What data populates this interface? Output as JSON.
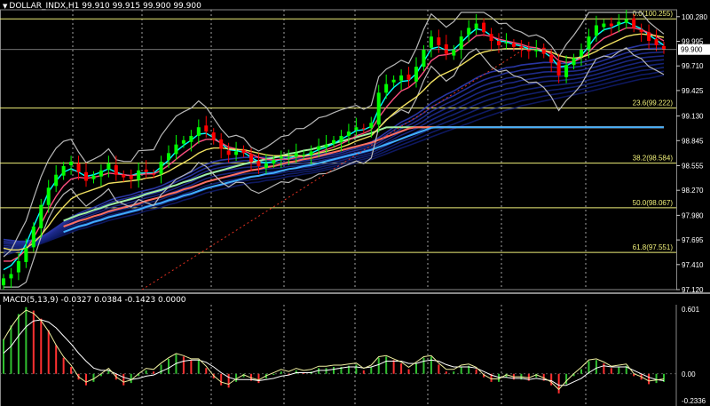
{
  "main_header": {
    "symbol": "DOLLAR_INDX,H1",
    "quote": "99.910 99.915 99.900 99.900",
    "menu_icon": "triangle-down-icon"
  },
  "macd_header": {
    "label": "MACD(5,13,9) -0.0327 0.0384 -0.1423 0.0000"
  },
  "colors": {
    "background": "#000000",
    "bull": "#00ff00",
    "bear": "#ff0000",
    "grid": "#ffffff",
    "fib": "#f0f07a",
    "price_label_bg": "#ffffff",
    "macd_line": "#ffffff"
  },
  "chart_data": [
    {
      "type": "candlestick",
      "title": "DOLLAR_INDX,H1",
      "ylim": [
        97.12,
        100.36
      ],
      "y_ticks": [
        "100.280",
        "99.995",
        "99.710",
        "99.425",
        "99.130",
        "98.845",
        "98.555",
        "98.270",
        "97.980",
        "97.695",
        "97.410",
        "97.120"
      ],
      "last_price": "99.900",
      "fibonacci_levels": [
        {
          "label": "0.0(100.255)",
          "value": 100.255
        },
        {
          "label": "23.6(99.222)",
          "value": 99.222
        },
        {
          "label": "38.2(98.584)",
          "value": 98.584
        },
        {
          "label": "50.0(98.067)",
          "value": 98.067
        },
        {
          "label": "61.8(97.551)",
          "value": 97.551
        }
      ],
      "close": [
        97.25,
        97.3,
        97.45,
        97.6,
        97.85,
        98.1,
        98.3,
        98.45,
        98.55,
        98.6,
        98.48,
        98.38,
        98.44,
        98.5,
        98.58,
        98.45,
        98.42,
        98.4,
        98.5,
        98.48,
        98.46,
        98.6,
        98.7,
        98.8,
        98.85,
        98.9,
        99.0,
        98.95,
        98.85,
        98.75,
        98.68,
        98.72,
        98.7,
        98.6,
        98.55,
        98.58,
        98.62,
        98.66,
        98.65,
        98.7,
        98.68,
        98.72,
        98.78,
        98.8,
        98.85,
        98.9,
        98.95,
        99.0,
        98.98,
        99.05,
        99.4,
        99.5,
        99.55,
        99.6,
        99.55,
        99.7,
        99.9,
        100.05,
        99.95,
        99.85,
        99.9,
        100.05,
        100.15,
        100.2,
        100.1,
        100.0,
        99.95,
        99.98,
        99.93,
        99.92,
        99.88,
        99.9,
        99.85,
        99.75,
        99.6,
        99.72,
        99.8,
        99.9,
        100.05,
        100.18,
        100.2,
        100.17,
        100.22,
        100.25,
        100.15,
        100.1,
        100.0,
        99.95,
        99.9
      ],
      "moving_averages": [
        {
          "color": "#00ffff",
          "values": [
            97.35,
            97.4,
            97.5,
            97.65,
            97.85,
            98.05,
            98.25,
            98.38,
            98.48,
            98.52,
            98.48,
            98.43,
            98.45,
            98.48,
            98.52,
            98.48,
            98.45,
            98.44,
            98.47,
            98.47,
            98.47,
            98.54,
            98.62,
            98.72,
            98.79,
            98.85,
            98.92,
            98.93,
            98.88,
            98.81,
            98.74,
            98.73,
            98.71,
            98.65,
            98.6,
            98.59,
            98.6,
            98.63,
            98.64,
            98.67,
            98.67,
            98.7,
            98.74,
            98.77,
            98.81,
            98.86,
            98.91,
            98.96,
            98.97,
            99.01,
            99.21,
            99.36,
            99.46,
            99.53,
            99.54,
            99.62,
            99.76,
            99.91,
            99.93,
            99.89,
            99.9,
            99.98,
            100.07,
            100.14,
            100.12,
            100.06,
            100.0,
            99.99,
            99.96,
            99.94,
            99.91,
            99.9,
            99.87,
            99.81,
            99.7,
            99.71,
            99.76,
            99.83,
            99.94,
            100.06,
            100.13,
            100.15,
            100.19,
            100.22,
            100.18,
            100.14,
            100.07,
            100.01,
            99.95
          ]
        },
        {
          "color": "#ff5080",
          "values": [
            97.45,
            97.45,
            97.5,
            97.58,
            97.72,
            97.88,
            98.05,
            98.2,
            98.32,
            98.4,
            98.42,
            98.41,
            98.42,
            98.44,
            98.47,
            98.46,
            98.45,
            98.44,
            98.45,
            98.46,
            98.46,
            98.5,
            98.56,
            98.63,
            98.7,
            98.76,
            98.83,
            98.86,
            98.86,
            98.82,
            98.77,
            98.75,
            98.73,
            98.69,
            98.65,
            98.63,
            98.62,
            98.63,
            98.63,
            98.65,
            98.66,
            98.68,
            98.71,
            98.74,
            98.77,
            98.81,
            98.85,
            98.9,
            98.93,
            98.97,
            99.11,
            99.23,
            99.33,
            99.42,
            99.46,
            99.53,
            99.64,
            99.77,
            99.83,
            99.84,
            99.86,
            99.92,
            99.99,
            100.06,
            100.07,
            100.05,
            100.02,
            100.0,
            99.98,
            99.96,
            99.93,
            99.92,
            99.89,
            99.85,
            99.77,
            99.75,
            99.76,
            99.8,
            99.87,
            99.96,
            100.03,
            100.07,
            100.11,
            100.15,
            100.15,
            100.13,
            100.09,
            100.05,
            100.0
          ]
        },
        {
          "color": "#f0e060",
          "values": [
            97.6,
            97.58,
            97.58,
            97.6,
            97.66,
            97.75,
            97.86,
            97.98,
            98.08,
            98.17,
            98.22,
            98.25,
            98.28,
            98.31,
            98.35,
            98.36,
            98.37,
            98.38,
            98.39,
            98.41,
            98.42,
            98.45,
            98.49,
            98.54,
            98.59,
            98.64,
            98.7,
            98.74,
            98.76,
            98.76,
            98.75,
            98.74,
            98.74,
            98.72,
            98.7,
            98.68,
            98.67,
            98.67,
            98.67,
            98.67,
            98.67,
            98.68,
            98.7,
            98.72,
            98.74,
            98.77,
            98.8,
            98.84,
            98.87,
            98.9,
            98.99,
            99.08,
            99.16,
            99.23,
            99.29,
            99.35,
            99.43,
            99.52,
            99.59,
            99.63,
            99.67,
            99.72,
            99.78,
            99.84,
            99.87,
            99.89,
            99.9,
            99.91,
            99.91,
            99.91,
            99.9,
            99.9,
            99.89,
            99.87,
            99.83,
            99.81,
            99.8,
            99.81,
            99.84,
            99.88,
            99.93,
            99.97,
            100.01,
            100.05,
            100.07,
            100.08,
            100.07,
            100.06,
            100.04
          ]
        },
        {
          "color": "#ff7040",
          "values": [
            97.7,
            97.69,
            97.68,
            97.68,
            97.7,
            97.73,
            97.78,
            97.84,
            97.9,
            97.96,
            98.0,
            98.04,
            98.07,
            98.11,
            98.15,
            98.18,
            98.2,
            98.22,
            98.25,
            98.27,
            98.29,
            98.32,
            98.36,
            98.4,
            98.44,
            98.48,
            98.53,
            98.57,
            98.6,
            98.62,
            98.63,
            98.64,
            98.65,
            98.65,
            98.65,
            98.65,
            98.65,
            98.65,
            98.66,
            98.66,
            98.66,
            98.67,
            98.68,
            98.7,
            98.71,
            98.73,
            98.76,
            98.78,
            98.8,
            98.83,
            98.88,
            98.94,
            99.0,
            99.06,
            99.1,
            99.15,
            99.21,
            99.28,
            99.33,
            99.38,
            99.42,
            99.47,
            99.52,
            99.57,
            99.61,
            99.64,
            99.66,
            99.69,
            99.7,
            99.72,
            99.73,
            99.74,
            99.75,
            99.75,
            99.74,
            99.74,
            99.74,
            99.75,
            99.77,
            99.79,
            99.82,
            99.85,
            99.88,
            99.91,
            99.93,
            99.95,
            99.96,
            99.96,
            99.96
          ]
        },
        {
          "color": "#d0f080",
          "values": [
            97.55,
            97.58,
            97.61,
            97.64,
            97.67,
            97.7,
            97.73,
            97.76,
            97.79,
            97.82,
            97.85,
            97.87,
            97.9,
            97.92,
            97.95,
            97.97,
            97.99,
            98.01,
            98.03,
            98.06,
            98.08,
            98.1,
            98.13,
            98.15,
            98.18,
            98.2,
            98.23,
            98.26,
            98.28,
            98.3,
            98.32,
            98.34,
            98.36,
            98.38,
            98.39,
            98.41,
            98.42,
            98.44,
            98.46,
            98.47,
            98.49,
            98.5,
            98.52,
            98.54,
            98.56,
            98.58,
            98.6,
            98.62,
            98.64,
            98.66,
            98.69,
            98.72,
            98.75,
            98.78,
            98.81,
            98.84,
            98.87,
            98.9,
            98.93,
            98.96,
            98.99,
            99.02,
            99.05,
            99.08,
            99.11,
            99.14,
            99.17,
            99.2,
            99.22,
            99.25,
            99.27,
            99.29,
            99.31,
            99.33,
            99.35,
            99.37,
            99.39,
            99.41,
            99.43,
            99.45,
            99.47,
            99.49,
            99.51,
            99.53,
            99.55,
            99.57,
            99.58,
            99.6,
            99.62
          ]
        }
      ]
    },
    {
      "type": "bar",
      "title": "MACD(5,13,9) -0.0327 0.0384 -0.1423 0.0000",
      "ylim": [
        -0.2336,
        0.601
      ],
      "y_ticks": [
        "0.601",
        "0.00",
        "-0.2336"
      ],
      "values": [
        0.3,
        0.42,
        0.52,
        0.58,
        0.55,
        0.48,
        0.38,
        0.25,
        0.14,
        0.06,
        -0.05,
        -0.1,
        -0.07,
        -0.02,
        0.03,
        -0.05,
        -0.1,
        -0.08,
        -0.02,
        0.03,
        0.02,
        0.08,
        0.13,
        0.17,
        0.15,
        0.12,
        0.12,
        0.05,
        -0.04,
        -0.1,
        -0.12,
        -0.07,
        -0.03,
        -0.06,
        -0.08,
        -0.04,
        -0.01,
        0.02,
        0.0,
        0.03,
        0.01,
        0.02,
        0.05,
        0.05,
        0.06,
        0.06,
        0.07,
        0.08,
        0.03,
        0.06,
        0.14,
        0.15,
        0.12,
        0.09,
        0.04,
        0.09,
        0.14,
        0.15,
        0.08,
        0.02,
        0.02,
        0.06,
        0.07,
        0.04,
        -0.03,
        -0.07,
        -0.07,
        -0.03,
        -0.05,
        -0.05,
        -0.06,
        -0.03,
        -0.06,
        -0.1,
        -0.17,
        -0.09,
        -0.02,
        0.04,
        0.11,
        0.12,
        0.09,
        0.05,
        0.06,
        0.07,
        -0.02,
        -0.05,
        -0.09,
        -0.08,
        -0.07
      ],
      "signal": [
        0.18,
        0.24,
        0.33,
        0.41,
        0.46,
        0.47,
        0.45,
        0.4,
        0.33,
        0.26,
        0.18,
        0.11,
        0.05,
        0.03,
        0.03,
        0.0,
        -0.03,
        -0.05,
        -0.04,
        -0.02,
        -0.01,
        0.02,
        0.05,
        0.09,
        0.11,
        0.12,
        0.12,
        0.1,
        0.06,
        0.01,
        -0.03,
        -0.05,
        -0.05,
        -0.05,
        -0.06,
        -0.05,
        -0.04,
        -0.02,
        -0.01,
        0.01,
        0.01,
        0.01,
        0.03,
        0.03,
        0.04,
        0.05,
        0.06,
        0.06,
        0.05,
        0.06,
        0.08,
        0.11,
        0.11,
        0.11,
        0.09,
        0.09,
        0.11,
        0.12,
        0.11,
        0.08,
        0.06,
        0.06,
        0.06,
        0.05,
        0.02,
        -0.01,
        -0.03,
        -0.03,
        -0.04,
        -0.04,
        -0.05,
        -0.04,
        -0.05,
        -0.06,
        -0.1,
        -0.1,
        -0.07,
        -0.04,
        0.01,
        0.05,
        0.07,
        0.06,
        0.06,
        0.06,
        0.03,
        0.0,
        -0.03,
        -0.05,
        -0.06
      ]
    }
  ]
}
